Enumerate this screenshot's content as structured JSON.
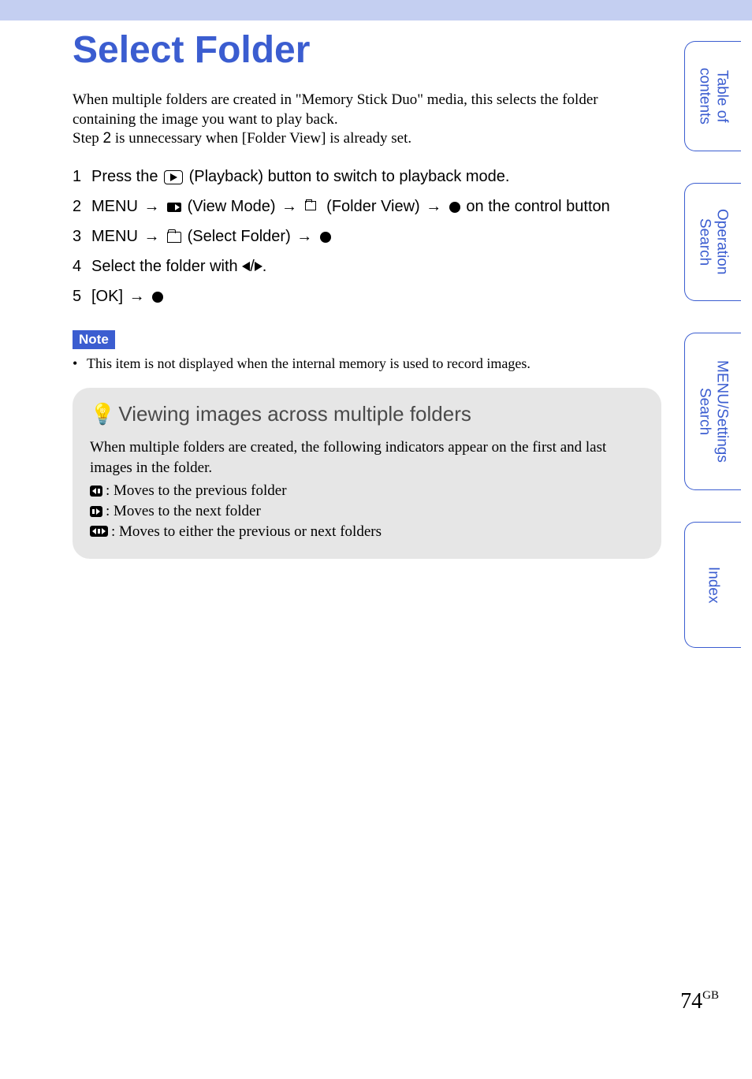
{
  "title": "Select Folder",
  "intro": {
    "line1": "When multiple folders are created in \"Memory Stick Duo\" media, this selects the folder containing the image you want to play back.",
    "line2_pre": "Step ",
    "line2_num": "2",
    "line2_post": " is unnecessary when [Folder View] is already set."
  },
  "steps": [
    {
      "num": "1",
      "pre": "Press the ",
      "post": " (Playback) button to switch to playback mode."
    },
    {
      "num": "2",
      "menu": "MENU",
      "vm": " (View Mode) ",
      "fv": " (Folder View) ",
      "end": " on the control button"
    },
    {
      "num": "3",
      "menu": "MENU",
      "sf": " (Select Folder) "
    },
    {
      "num": "4",
      "text": "Select the folder with "
    },
    {
      "num": "5",
      "text": "[OK] "
    }
  ],
  "note": {
    "label": "Note",
    "body": "This item is not displayed when the internal memory is used to record images."
  },
  "tip": {
    "title": "Viewing images across multiple folders",
    "intro": "When multiple folders are created, the following indicators appear on the first and last images in the folder.",
    "items": [
      ": Moves to the previous folder",
      ": Moves to the next folder",
      ": Moves to either the previous or next folders"
    ]
  },
  "tabs": {
    "t1": "Table of\ncontents",
    "t2": "Operation\nSearch",
    "t3": "MENU/Settings\nSearch",
    "t4": "Index"
  },
  "page": {
    "num": "74",
    "suffix": "GB"
  }
}
